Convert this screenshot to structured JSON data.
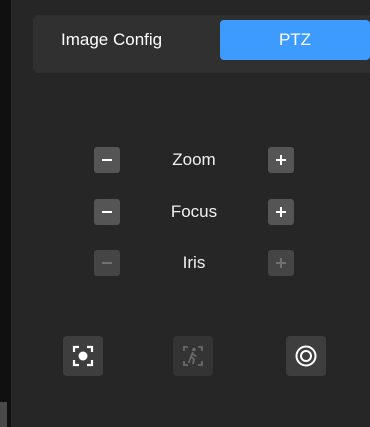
{
  "tabs": [
    {
      "label": "Image Config",
      "active": false
    },
    {
      "label": "PTZ",
      "active": true
    }
  ],
  "controls": [
    {
      "label": "Zoom",
      "enabled": true
    },
    {
      "label": "Focus",
      "enabled": true
    },
    {
      "label": "Iris",
      "enabled": false
    }
  ],
  "tools": [
    {
      "icon": "focus-frame-icon",
      "enabled": true
    },
    {
      "icon": "person-tracking-icon",
      "enabled": false
    },
    {
      "icon": "target-icon",
      "enabled": true
    }
  ],
  "colors": {
    "background": "#262626",
    "tab_bar": "#303030",
    "accent": "#3d9bff",
    "button": "#555555",
    "button_disabled": "#454545"
  }
}
